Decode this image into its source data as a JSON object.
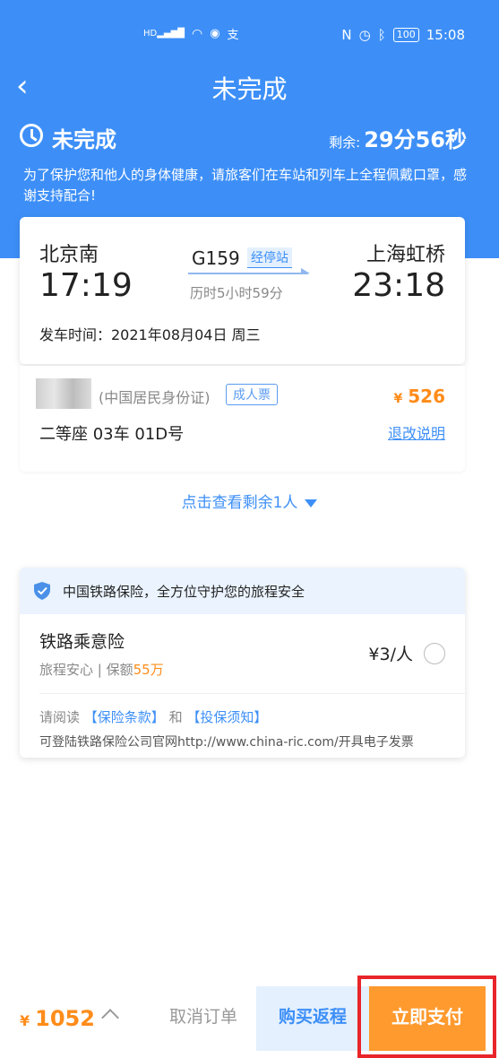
{
  "status_bar": {
    "time": "15:08",
    "battery": "100",
    "left_icons": [
      "hd-signal-icon",
      "wifi-icon",
      "wechat-icon",
      "alipay-icon"
    ],
    "right_icons": [
      "nfc-icon",
      "alarm-icon",
      "bluetooth-icon"
    ]
  },
  "header": {
    "title": "未完成"
  },
  "status": {
    "label": "未完成",
    "remaining_label": "剩余:",
    "remaining_value": "29分56秒"
  },
  "notice": "为了保护您和他人的身体健康，请旅客们在车站和列车上全程佩戴口罩，感谢支持配合!",
  "trip": {
    "from_station": "北京南",
    "to_station": "上海虹桥",
    "from_time": "17:19",
    "to_time": "23:18",
    "train_no": "G159",
    "stops_link": "经停站",
    "duration": "历时5小时59分",
    "depart_date": "发车时间：2021年08月04日 周三"
  },
  "passenger": {
    "id_type": "(中国居民身份证)",
    "ticket_type": "成人票",
    "currency": "¥",
    "price": "526",
    "seat": "二等座 03车 01D号",
    "refund_link": "退改说明"
  },
  "more_link": "点击查看剩余1人",
  "insurance": {
    "header": "中国铁路保险，全方位守护您的旅程安全",
    "name": "铁路乘意险",
    "desc_prefix": "旅程安心 | 保额",
    "desc_amount": "55万",
    "price": "¥3/人",
    "read_prefix": "请阅读",
    "terms_link": "【保险条款】",
    "and": "和",
    "notice_link": "【投保须知】",
    "site_text": "可登陆铁路保险公司官网http://www.china-ric.com/开具电子发票"
  },
  "bottom": {
    "currency": "¥",
    "total": "1052",
    "cancel": "取消订单",
    "return_trip": "购买返程",
    "pay": "立即支付"
  },
  "colors": {
    "primary": "#3d8ff7",
    "accent": "#ff8c1a",
    "highlight": "#e8252b"
  }
}
